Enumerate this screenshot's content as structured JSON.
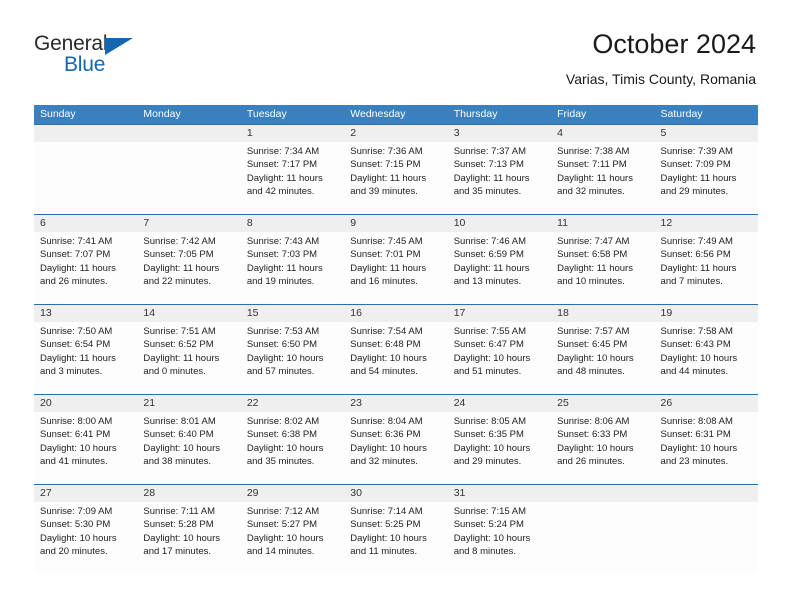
{
  "brand": {
    "name_part1": "General",
    "name_part2": "Blue",
    "triangle_color": "#1367b0"
  },
  "header": {
    "title": "October 2024",
    "subtitle": "Varias, Timis County, Romania",
    "header_bg_color": "#3a7fbe",
    "rule_color": "#2f6ea5",
    "daynum_band_color": "#efefef"
  },
  "weekdays": [
    "Sunday",
    "Monday",
    "Tuesday",
    "Wednesday",
    "Thursday",
    "Friday",
    "Saturday"
  ],
  "weeks": [
    {
      "days": [
        {
          "num": "",
          "sunrise": "",
          "sunset": "",
          "daylight": ""
        },
        {
          "num": "",
          "sunrise": "",
          "sunset": "",
          "daylight": ""
        },
        {
          "num": "1",
          "sunrise": "Sunrise: 7:34 AM",
          "sunset": "Sunset: 7:17 PM",
          "daylight": "Daylight: 11 hours and 42 minutes."
        },
        {
          "num": "2",
          "sunrise": "Sunrise: 7:36 AM",
          "sunset": "Sunset: 7:15 PM",
          "daylight": "Daylight: 11 hours and 39 minutes."
        },
        {
          "num": "3",
          "sunrise": "Sunrise: 7:37 AM",
          "sunset": "Sunset: 7:13 PM",
          "daylight": "Daylight: 11 hours and 35 minutes."
        },
        {
          "num": "4",
          "sunrise": "Sunrise: 7:38 AM",
          "sunset": "Sunset: 7:11 PM",
          "daylight": "Daylight: 11 hours and 32 minutes."
        },
        {
          "num": "5",
          "sunrise": "Sunrise: 7:39 AM",
          "sunset": "Sunset: 7:09 PM",
          "daylight": "Daylight: 11 hours and 29 minutes."
        }
      ]
    },
    {
      "days": [
        {
          "num": "6",
          "sunrise": "Sunrise: 7:41 AM",
          "sunset": "Sunset: 7:07 PM",
          "daylight": "Daylight: 11 hours and 26 minutes."
        },
        {
          "num": "7",
          "sunrise": "Sunrise: 7:42 AM",
          "sunset": "Sunset: 7:05 PM",
          "daylight": "Daylight: 11 hours and 22 minutes."
        },
        {
          "num": "8",
          "sunrise": "Sunrise: 7:43 AM",
          "sunset": "Sunset: 7:03 PM",
          "daylight": "Daylight: 11 hours and 19 minutes."
        },
        {
          "num": "9",
          "sunrise": "Sunrise: 7:45 AM",
          "sunset": "Sunset: 7:01 PM",
          "daylight": "Daylight: 11 hours and 16 minutes."
        },
        {
          "num": "10",
          "sunrise": "Sunrise: 7:46 AM",
          "sunset": "Sunset: 6:59 PM",
          "daylight": "Daylight: 11 hours and 13 minutes."
        },
        {
          "num": "11",
          "sunrise": "Sunrise: 7:47 AM",
          "sunset": "Sunset: 6:58 PM",
          "daylight": "Daylight: 11 hours and 10 minutes."
        },
        {
          "num": "12",
          "sunrise": "Sunrise: 7:49 AM",
          "sunset": "Sunset: 6:56 PM",
          "daylight": "Daylight: 11 hours and 7 minutes."
        }
      ]
    },
    {
      "days": [
        {
          "num": "13",
          "sunrise": "Sunrise: 7:50 AM",
          "sunset": "Sunset: 6:54 PM",
          "daylight": "Daylight: 11 hours and 3 minutes."
        },
        {
          "num": "14",
          "sunrise": "Sunrise: 7:51 AM",
          "sunset": "Sunset: 6:52 PM",
          "daylight": "Daylight: 11 hours and 0 minutes."
        },
        {
          "num": "15",
          "sunrise": "Sunrise: 7:53 AM",
          "sunset": "Sunset: 6:50 PM",
          "daylight": "Daylight: 10 hours and 57 minutes."
        },
        {
          "num": "16",
          "sunrise": "Sunrise: 7:54 AM",
          "sunset": "Sunset: 6:48 PM",
          "daylight": "Daylight: 10 hours and 54 minutes."
        },
        {
          "num": "17",
          "sunrise": "Sunrise: 7:55 AM",
          "sunset": "Sunset: 6:47 PM",
          "daylight": "Daylight: 10 hours and 51 minutes."
        },
        {
          "num": "18",
          "sunrise": "Sunrise: 7:57 AM",
          "sunset": "Sunset: 6:45 PM",
          "daylight": "Daylight: 10 hours and 48 minutes."
        },
        {
          "num": "19",
          "sunrise": "Sunrise: 7:58 AM",
          "sunset": "Sunset: 6:43 PM",
          "daylight": "Daylight: 10 hours and 44 minutes."
        }
      ]
    },
    {
      "days": [
        {
          "num": "20",
          "sunrise": "Sunrise: 8:00 AM",
          "sunset": "Sunset: 6:41 PM",
          "daylight": "Daylight: 10 hours and 41 minutes."
        },
        {
          "num": "21",
          "sunrise": "Sunrise: 8:01 AM",
          "sunset": "Sunset: 6:40 PM",
          "daylight": "Daylight: 10 hours and 38 minutes."
        },
        {
          "num": "22",
          "sunrise": "Sunrise: 8:02 AM",
          "sunset": "Sunset: 6:38 PM",
          "daylight": "Daylight: 10 hours and 35 minutes."
        },
        {
          "num": "23",
          "sunrise": "Sunrise: 8:04 AM",
          "sunset": "Sunset: 6:36 PM",
          "daylight": "Daylight: 10 hours and 32 minutes."
        },
        {
          "num": "24",
          "sunrise": "Sunrise: 8:05 AM",
          "sunset": "Sunset: 6:35 PM",
          "daylight": "Daylight: 10 hours and 29 minutes."
        },
        {
          "num": "25",
          "sunrise": "Sunrise: 8:06 AM",
          "sunset": "Sunset: 6:33 PM",
          "daylight": "Daylight: 10 hours and 26 minutes."
        },
        {
          "num": "26",
          "sunrise": "Sunrise: 8:08 AM",
          "sunset": "Sunset: 6:31 PM",
          "daylight": "Daylight: 10 hours and 23 minutes."
        }
      ]
    },
    {
      "days": [
        {
          "num": "27",
          "sunrise": "Sunrise: 7:09 AM",
          "sunset": "Sunset: 5:30 PM",
          "daylight": "Daylight: 10 hours and 20 minutes."
        },
        {
          "num": "28",
          "sunrise": "Sunrise: 7:11 AM",
          "sunset": "Sunset: 5:28 PM",
          "daylight": "Daylight: 10 hours and 17 minutes."
        },
        {
          "num": "29",
          "sunrise": "Sunrise: 7:12 AM",
          "sunset": "Sunset: 5:27 PM",
          "daylight": "Daylight: 10 hours and 14 minutes."
        },
        {
          "num": "30",
          "sunrise": "Sunrise: 7:14 AM",
          "sunset": "Sunset: 5:25 PM",
          "daylight": "Daylight: 10 hours and 11 minutes."
        },
        {
          "num": "31",
          "sunrise": "Sunrise: 7:15 AM",
          "sunset": "Sunset: 5:24 PM",
          "daylight": "Daylight: 10 hours and 8 minutes."
        },
        {
          "num": "",
          "sunrise": "",
          "sunset": "",
          "daylight": ""
        },
        {
          "num": "",
          "sunrise": "",
          "sunset": "",
          "daylight": ""
        }
      ]
    }
  ]
}
